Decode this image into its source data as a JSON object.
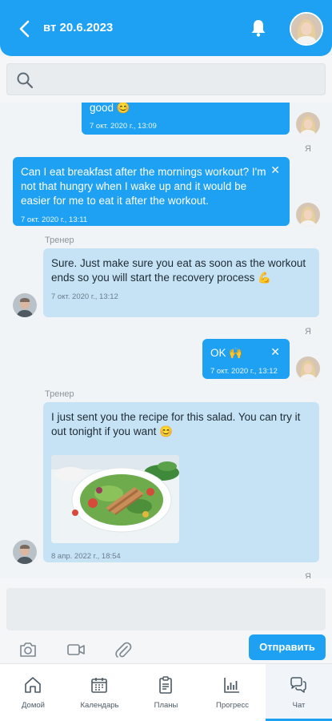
{
  "header": {
    "title": "вт 20.6.2023",
    "accent": "#1ea1f2"
  },
  "search": {
    "placeholder": ""
  },
  "messages": [
    {
      "from": "me",
      "text": "good 😊",
      "time": "7 окт. 2020 г., 13:09"
    },
    {
      "from": "me",
      "sender_label": "Я",
      "text": "Can I eat breakfast after the mornings workout? I'm not that hungry when I wake up and it would be easier for me to eat it after the workout.",
      "time": "7 окт. 2020 г., 13:11"
    },
    {
      "from": "them",
      "sender_label": "Тренер",
      "text": "Sure. Just make sure you eat as soon as the workout ends so you will start the recovery process 💪",
      "time": "7 окт. 2020 г., 13:12"
    },
    {
      "from": "me",
      "sender_label": "Я",
      "text": "OK 🙌",
      "time": "7 окт. 2020 г., 13:12"
    },
    {
      "from": "them",
      "sender_label": "Тренер",
      "text": "I just sent you the recipe for this salad. You can try it out tonight if you want 😊",
      "time": "8 апр. 2022 г., 18:54"
    },
    {
      "from": "me",
      "sender_label": "Я"
    }
  ],
  "composer": {
    "placeholder": "",
    "send_label": "Отправить",
    "tools": [
      "camera-icon",
      "video-icon",
      "attachment-icon"
    ]
  },
  "tabs": [
    {
      "label": "Домой",
      "icon": "home-icon"
    },
    {
      "label": "Календарь",
      "icon": "calendar-icon"
    },
    {
      "label": "Планы",
      "icon": "clipboard-icon"
    },
    {
      "label": "Прогресс",
      "icon": "chart-icon"
    },
    {
      "label": "Чат",
      "icon": "chat-icon",
      "active": true
    }
  ]
}
